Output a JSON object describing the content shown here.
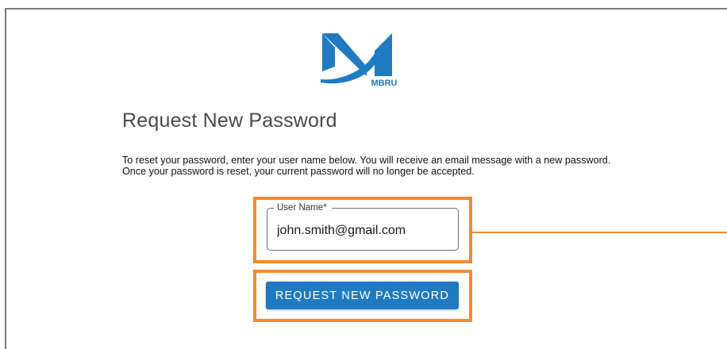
{
  "logo": {
    "text": "MBRU",
    "brand_color": "#1f7ac1"
  },
  "page": {
    "title": "Request New Password",
    "instructions": "To reset your password, enter your user name below. You will receive an email message with a new password. Once your password is reset, your current password will no longer be accepted."
  },
  "form": {
    "username_label": "User Name*",
    "username_value": "john.smith@gmail.com",
    "submit_label": "REQUEST NEW PASSWORD"
  },
  "colors": {
    "accent": "#1f7ac1",
    "highlight": "#f28a30",
    "title_text": "#4a4a4a"
  }
}
